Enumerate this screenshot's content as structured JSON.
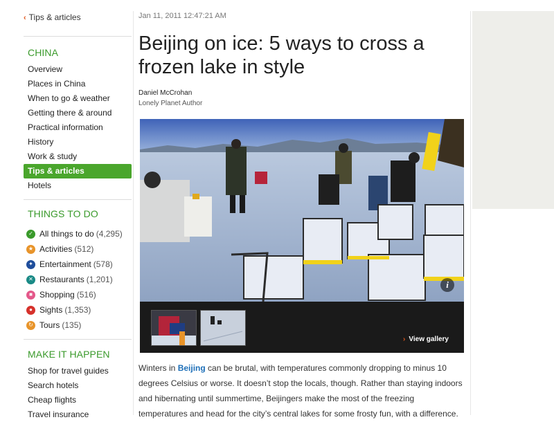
{
  "left_nav": {
    "back_label": "Tips & articles",
    "section1_title": "CHINA",
    "items": [
      {
        "label": "Overview",
        "active": false
      },
      {
        "label": "Places in China",
        "active": false
      },
      {
        "label": "When to go & weather",
        "active": false
      },
      {
        "label": "Getting there & around",
        "active": false
      },
      {
        "label": "Practical information",
        "active": false
      },
      {
        "label": "History",
        "active": false
      },
      {
        "label": "Work & study",
        "active": false
      },
      {
        "label": "Tips & articles",
        "active": true
      },
      {
        "label": "Hotels",
        "active": false
      }
    ],
    "section2_title": "THINGS TO DO",
    "things": [
      {
        "label": "All things to do",
        "count": "(4,295)",
        "icon": "check-icon",
        "color": "#3a9a2b"
      },
      {
        "label": "Activities",
        "count": "(512)",
        "icon": "activities-icon",
        "color": "#e8942a"
      },
      {
        "label": "Entertainment",
        "count": "(578)",
        "icon": "entertainment-icon",
        "color": "#1f4e9c"
      },
      {
        "label": "Restaurants",
        "count": "(1,201)",
        "icon": "restaurants-icon",
        "color": "#1a8a86"
      },
      {
        "label": "Shopping",
        "count": "(516)",
        "icon": "shopping-icon",
        "color": "#e4588a"
      },
      {
        "label": "Sights",
        "count": "(1,353)",
        "icon": "sights-icon",
        "color": "#d6312b"
      },
      {
        "label": "Tours",
        "count": "(135)",
        "icon": "tours-icon",
        "color": "#e8942a"
      }
    ],
    "section3_title": "MAKE IT HAPPEN",
    "happen": [
      {
        "label": "Shop for travel guides"
      },
      {
        "label": "Search hotels"
      },
      {
        "label": "Cheap flights"
      },
      {
        "label": "Travel insurance"
      }
    ]
  },
  "article": {
    "date": "Jan 11, 2011 12:47:21 AM",
    "title": "Beijing on ice: 5 ways to cross a frozen lake in style",
    "author": "Daniel McCrohan",
    "author_role": "Lonely Planet Author",
    "view_gallery": "View gallery",
    "body_pre": "Winters in ",
    "body_link": "Beijing",
    "body_post": " can be brutal, with temperatures commonly dropping to minus 10 degrees Celsius or worse. It doesn’t stop the locals, though. Rather than staying indoors and hibernating until summertime, Beijingers make the most of the freezing temperatures and head for the city’s central lakes for some frosty fun, with a difference."
  },
  "colors": {
    "accent_green": "#4aa62c",
    "section_green": "#3a9a2b",
    "link_blue": "#1d6fb8",
    "chevron_orange": "#e0561b"
  }
}
